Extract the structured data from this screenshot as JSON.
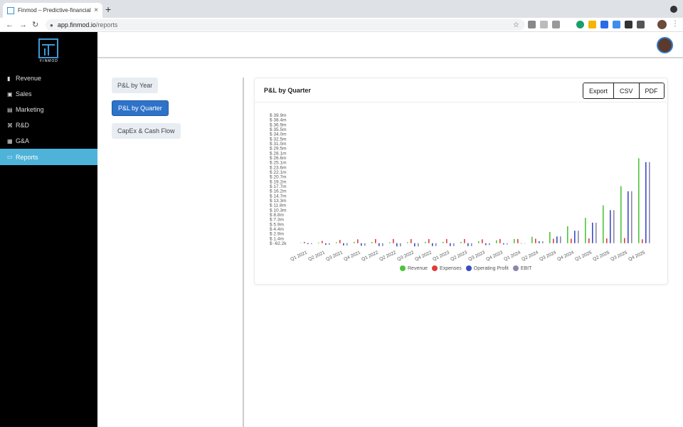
{
  "browser": {
    "tab_title": "Finmod – Predictive-financial m",
    "tab_close": "×",
    "new_tab": "+",
    "url_host": "app.finmod.io",
    "url_path": "/reports",
    "back": "←",
    "forward": "→",
    "reload": "↻",
    "star": "☆",
    "kebab": "⋮"
  },
  "sidebar": {
    "logo_text": "FINMOD",
    "items": [
      {
        "label": "Revenue",
        "icon": "bar-chart-icon",
        "glyph": "▮"
      },
      {
        "label": "Sales",
        "icon": "sales-icon",
        "glyph": "▣"
      },
      {
        "label": "Marketing",
        "icon": "calendar-icon",
        "glyph": "▤"
      },
      {
        "label": "R&D",
        "icon": "command-icon",
        "glyph": "⌘"
      },
      {
        "label": "G&A",
        "icon": "document-icon",
        "glyph": "▦"
      },
      {
        "label": "Reports",
        "icon": "folder-icon",
        "glyph": "▭"
      }
    ],
    "active": "Reports"
  },
  "reports": {
    "buttons": [
      "P&L by Year",
      "P&L by Quarter",
      "CapEx & Cash Flow"
    ],
    "active": "P&L by Quarter"
  },
  "card": {
    "title": "P&L by Quarter",
    "export_buttons": [
      "Export",
      "CSV",
      "PDF"
    ]
  },
  "colors": {
    "revenue": "#4cc43a",
    "expenses": "#e23b3b",
    "operating_profit": "#3b4bc4",
    "ebit": "#8888aa",
    "accent": "#2e73c9",
    "sidebar_active": "#4fb3d9"
  },
  "chart_data": {
    "type": "bar",
    "title": "",
    "y_ticks": [
      "$ 39.9m",
      "$ 38.4m",
      "$ 36.9m",
      "$ 35.5m",
      "$ 34.0m",
      "$ 32.5m",
      "$ 31.0m",
      "$ 29.5m",
      "$ 28.1m",
      "$ 26.6m",
      "$ 25.1m",
      "$ 23.6m",
      "$ 22.1m",
      "$ 20.7m",
      "$ 19.2m",
      "$ 17.7m",
      "$ 16.2m",
      "$ 14.7m",
      "$ 13.3m",
      "$ 11.8m",
      "$ 10.3m",
      "$ 8.8m",
      "$ 7.3m",
      "$ 5.9m",
      "$ 4.4m",
      "$ 2.9m",
      "$ 1.4m",
      "$ -62.2k"
    ],
    "ylim": [
      -0.0622,
      39.9
    ],
    "categories": [
      "Q1 2021",
      "Q2 2021",
      "Q3 2021",
      "Q4 2021",
      "Q1 2022",
      "Q2 2022",
      "Q3 2022",
      "Q4 2022",
      "Q1 2023",
      "Q2 2023",
      "Q3 2023",
      "Q4 2023",
      "Q1 2024",
      "Q2 2024",
      "Q3 2024",
      "Q4 2024",
      "Q1 2025",
      "Q2 2025",
      "Q3 2025",
      "Q4 2025"
    ],
    "series": [
      {
        "name": "Revenue",
        "values": [
          0.1,
          0.2,
          0.3,
          0.4,
          0.4,
          0.3,
          0.3,
          0.4,
          0.4,
          0.4,
          0.6,
          0.9,
          1.3,
          2.0,
          3.5,
          5.3,
          7.9,
          11.8,
          17.8,
          26.5
        ]
      },
      {
        "name": "Expenses",
        "values": [
          0.4,
          0.7,
          1.0,
          1.2,
          1.3,
          1.3,
          1.3,
          1.3,
          1.3,
          1.3,
          1.2,
          1.3,
          1.3,
          1.4,
          1.4,
          1.4,
          1.5,
          1.5,
          1.6,
          1.2
        ]
      },
      {
        "name": "Operating Profit",
        "values": [
          -0.3,
          -0.5,
          -0.7,
          -0.8,
          -0.9,
          -1.0,
          -1.0,
          -0.9,
          -0.9,
          -0.9,
          -0.6,
          -0.4,
          0.0,
          0.6,
          2.1,
          3.9,
          6.4,
          10.3,
          16.2,
          25.3
        ]
      },
      {
        "name": "EBIT",
        "values": [
          -0.3,
          -0.5,
          -0.7,
          -0.8,
          -0.9,
          -1.0,
          -1.0,
          -0.9,
          -0.9,
          -0.9,
          -0.6,
          -0.4,
          0.0,
          0.6,
          2.1,
          3.9,
          6.4,
          10.3,
          16.2,
          25.3
        ]
      }
    ],
    "legend_position": "bottom",
    "grid": false
  }
}
